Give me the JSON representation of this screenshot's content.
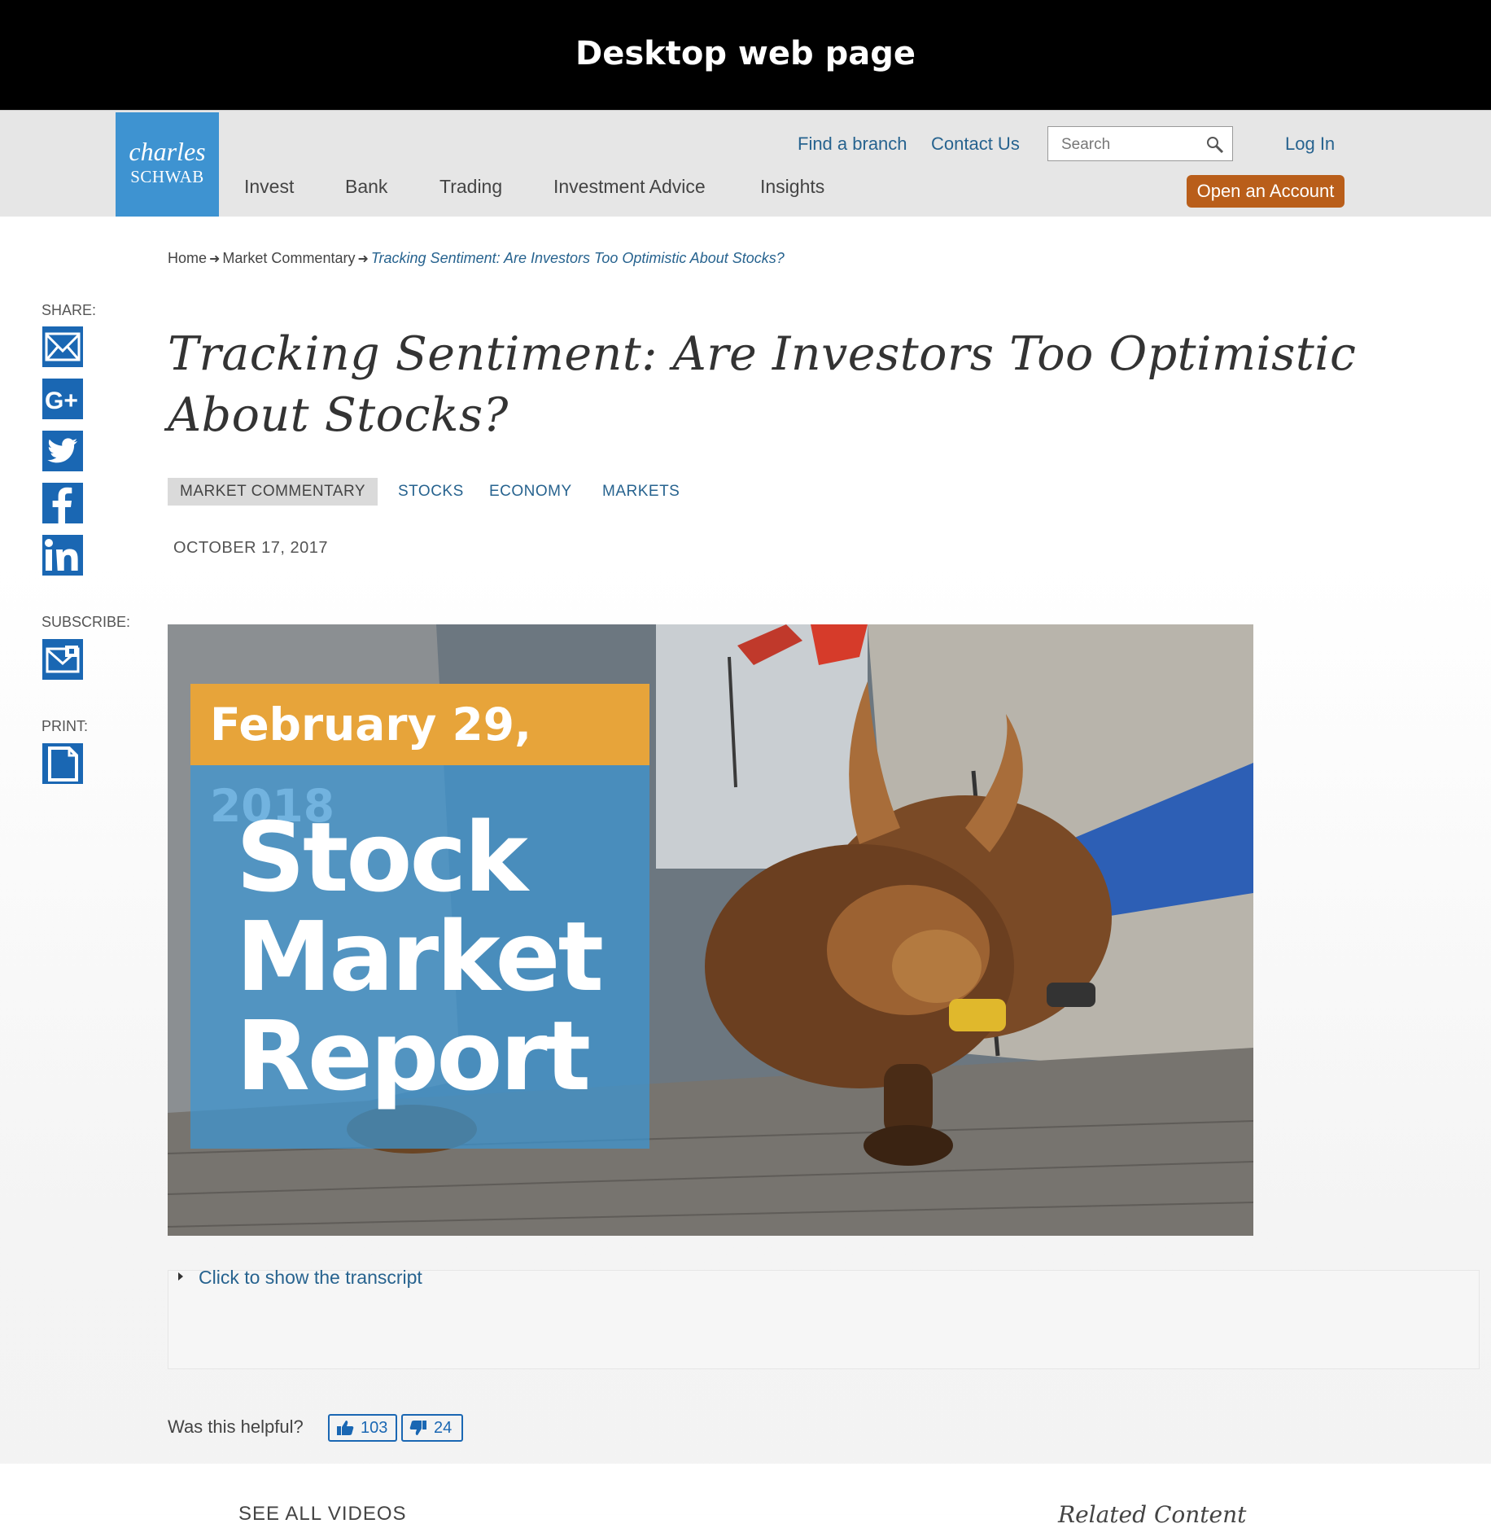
{
  "banner": {
    "title": "Desktop web page"
  },
  "header": {
    "logo": {
      "line1": "charles",
      "line2": "SCHWAB"
    },
    "nav": [
      "Invest",
      "Bank",
      "Trading",
      "Investment Advice",
      "Insights"
    ],
    "utility": {
      "find_branch": "Find a branch",
      "contact_us": "Contact Us",
      "log_in": "Log In"
    },
    "search": {
      "placeholder": "Search",
      "value": ""
    },
    "open_account": "Open an Account"
  },
  "breadcrumb": {
    "home": "Home",
    "section": "Market Commentary",
    "current": "Tracking Sentiment: Are Investors Too Optimistic About Stocks?"
  },
  "sidebar": {
    "share_label": "SHARE:",
    "share_icons": [
      "email-icon",
      "google-plus-icon",
      "twitter-icon",
      "facebook-icon",
      "linkedin-icon"
    ],
    "subscribe_label": "SUBSCRIBE:",
    "print_label": "PRINT:"
  },
  "article": {
    "title": "Tracking Sentiment: Are Investors Too Optimistic About Stocks?",
    "tags": [
      "MARKET COMMENTARY",
      "STOCKS",
      "ECONOMY",
      "MARKETS"
    ],
    "date": "OCTOBER 17, 2017",
    "hero": {
      "date": "February 29, 2018",
      "line1": "Stock",
      "line2": "Market",
      "line3": "Report"
    },
    "transcript_toggle": "Click to show the transcript"
  },
  "feedback": {
    "question": "Was this helpful?",
    "up_count": "103",
    "down_count": "24"
  },
  "footer": {
    "see_all": "SEE ALL VIDEOS",
    "related": "Related Content"
  },
  "colors": {
    "brand_blue": "#3e93d1",
    "link": "#27638f",
    "cta_orange": "#b95e1a",
    "icon_blue": "#1a67b3"
  }
}
